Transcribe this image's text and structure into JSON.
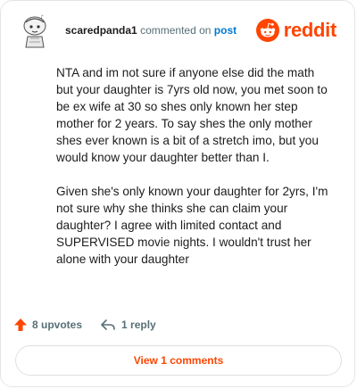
{
  "header": {
    "username": "scaredpanda1",
    "action_text": "commented on",
    "post_link": "post",
    "brand": "reddit"
  },
  "comment": {
    "paragraphs": [
      "NTA and im not sure if anyone else did the math but your daughter is 7yrs old now, you met soon to be ex wife at 30 so shes only known her step mother for 2 years. To say shes the only mother shes ever known is a bit of a stretch imo, but you would know your daughter better than I.",
      "Given she's only known your daughter for 2yrs, I'm not sure why she thinks she can claim your daughter? I agree with limited contact and SUPERVISED movie nights. I wouldn't trust her alone with your daughter"
    ]
  },
  "actions": {
    "upvotes": "8 upvotes",
    "reply": "1 reply"
  },
  "view_comments": "View 1 comments",
  "colors": {
    "brand": "#ff4500",
    "link": "#0079d3",
    "muted": "#576f76"
  },
  "icons": [
    "avatar",
    "reddit-logo-icon",
    "upvote-arrow-icon",
    "reply-arrow-icon"
  ]
}
